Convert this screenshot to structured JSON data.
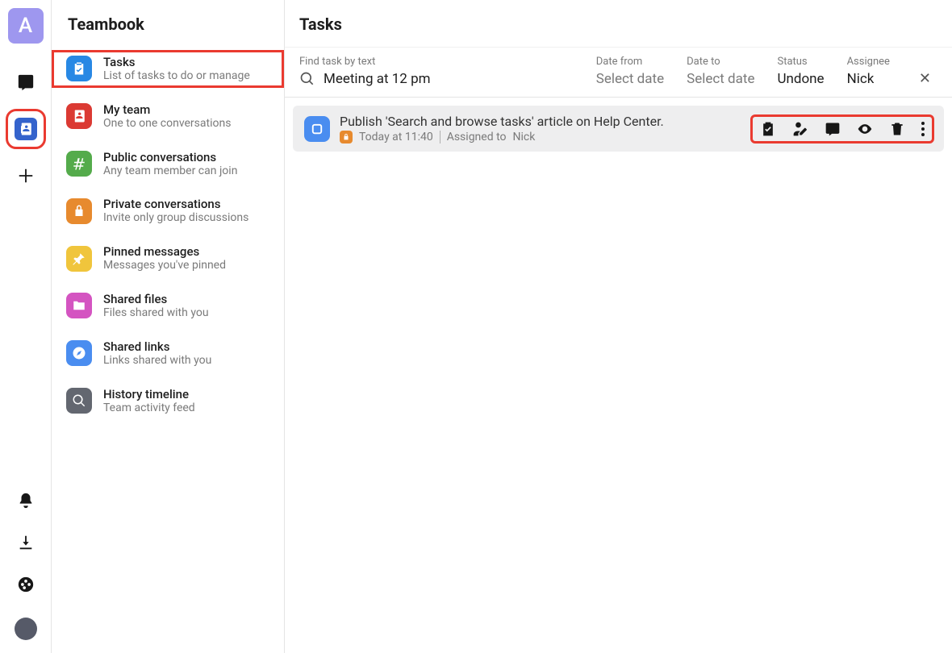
{
  "app": {
    "logo_letter": "A"
  },
  "sidebar": {
    "title": "Teambook",
    "items": [
      {
        "title": "Tasks",
        "desc": "List of tasks to do or manage",
        "color": "#2888e4",
        "icon": "clipboard"
      },
      {
        "title": "My team",
        "desc": "One to one conversations",
        "color": "#db3a33",
        "icon": "contacts"
      },
      {
        "title": "Public conversations",
        "desc": "Any team member can join",
        "color": "#54ab4b",
        "icon": "hash"
      },
      {
        "title": "Private conversations",
        "desc": "Invite only group discussions",
        "color": "#e78a2e",
        "icon": "lock"
      },
      {
        "title": "Pinned messages",
        "desc": "Messages you've pinned",
        "color": "#f0c53c",
        "icon": "pin"
      },
      {
        "title": "Shared files",
        "desc": "Files shared with you",
        "color": "#d454c1",
        "icon": "folder"
      },
      {
        "title": "Shared links",
        "desc": "Links shared with you",
        "color": "#4a8df0",
        "icon": "compass"
      },
      {
        "title": "History timeline",
        "desc": "Team activity feed",
        "color": "#636770",
        "icon": "search"
      }
    ]
  },
  "main": {
    "title": "Tasks",
    "filters": {
      "find_label": "Find task by text",
      "find_value": "Meeting at 12 pm",
      "date_from_label": "Date from",
      "date_from_value": "Select date",
      "date_to_label": "Date to",
      "date_to_value": "Select date",
      "status_label": "Status",
      "status_value": "Undone",
      "assignee_label": "Assignee",
      "assignee_value": "Nick"
    },
    "task": {
      "title": "Publish 'Search and browse tasks' article on Help Center.",
      "time": "Today at 11:40",
      "assigned_label": "Assigned to",
      "assignee": "Nick"
    }
  }
}
